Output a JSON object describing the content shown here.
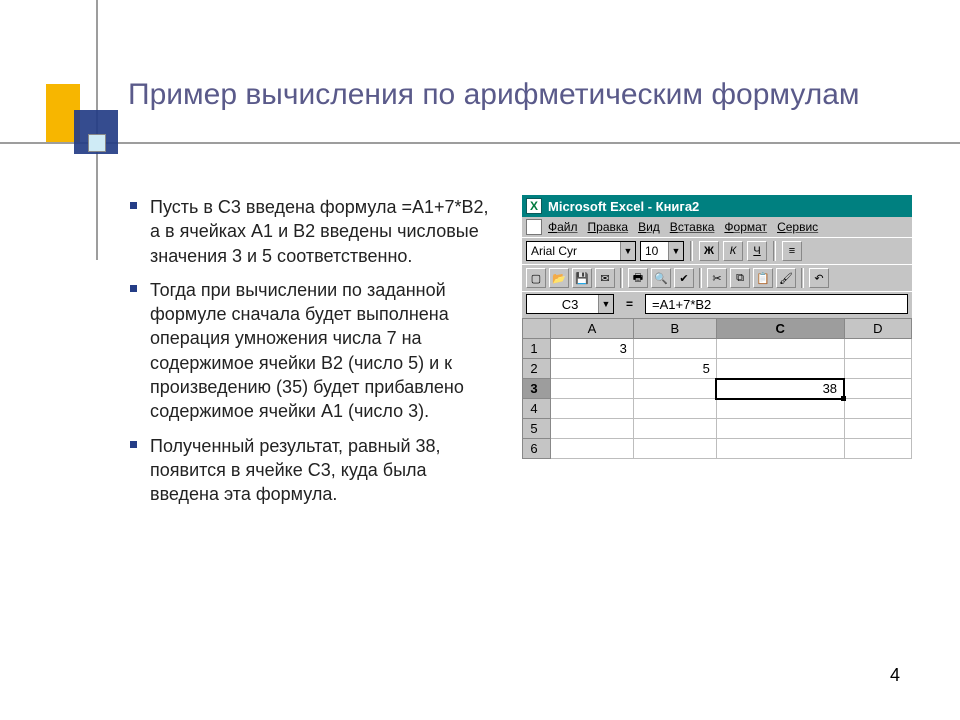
{
  "title": "Пример вычисления по арифметическим формулам",
  "bullets": [
    "Пусть в C3 введена формула =А1+7*В2, а в ячейках А1 и В2 введены числовые значения 3 и 5 соответственно.",
    "Тогда при вычислении по заданной формуле сначала будет выполнена операция умножения числа 7 на содержимое ячейки В2 (число 5) и к произведению (35) будет прибавлено содержимое ячейки А1 (число 3).",
    "Полученный результат, равный 38, появится в ячейке C3, куда была введена эта формула."
  ],
  "excel": {
    "title": "Microsoft Excel - Книга2",
    "menu": [
      "Файл",
      "Правка",
      "Вид",
      "Вставка",
      "Формат",
      "Сервис"
    ],
    "format_bar": {
      "font": "Arial Cyr",
      "size": "10",
      "bold": "Ж",
      "italic": "К",
      "underline": "Ч",
      "align": "≡"
    },
    "name_box": "C3",
    "eq": "=",
    "formula": "=A1+7*B2",
    "columns": [
      "A",
      "B",
      "C",
      "D"
    ],
    "rows": [
      "1",
      "2",
      "3",
      "4",
      "5",
      "6"
    ],
    "selected_col": "C",
    "selected_row": "3",
    "cells": {
      "A1": "3",
      "B2": "5",
      "C3": "38"
    }
  },
  "page_number": "4"
}
